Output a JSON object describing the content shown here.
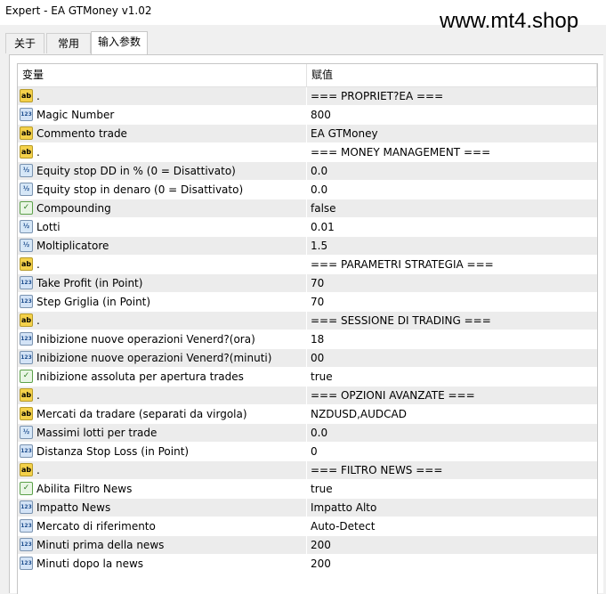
{
  "window": {
    "title": "Expert - EA GTMoney v1.02",
    "watermark": "www.mt4.shop"
  },
  "tabs": [
    {
      "label": "关于"
    },
    {
      "label": "常用"
    },
    {
      "label": "输入参数"
    }
  ],
  "table": {
    "headers": {
      "variable": "变量",
      "value": "赋值"
    },
    "icons": {
      "ab": {
        "glyph": "ab",
        "name": "string-type-icon"
      },
      "int": {
        "glyph": "123",
        "name": "integer-type-icon"
      },
      "dbl": {
        "glyph": "½",
        "name": "double-type-icon"
      },
      "bool": {
        "glyph": "✓",
        "name": "boolean-type-icon"
      }
    },
    "rows": [
      {
        "type": "ab",
        "name": ".",
        "value": "=== PROPRIET?EA ==="
      },
      {
        "type": "int",
        "name": "Magic Number",
        "value": "800"
      },
      {
        "type": "ab",
        "name": "Commento trade",
        "value": "EA GTMoney"
      },
      {
        "type": "ab",
        "name": ".",
        "value": "=== MONEY MANAGEMENT ==="
      },
      {
        "type": "dbl",
        "name": "Equity stop DD in % (0 = Disattivato)",
        "value": "0.0"
      },
      {
        "type": "dbl",
        "name": "Equity stop in denaro (0 = Disattivato)",
        "value": "0.0"
      },
      {
        "type": "bool",
        "name": "Compounding",
        "value": "false"
      },
      {
        "type": "dbl",
        "name": "Lotti",
        "value": "0.01"
      },
      {
        "type": "dbl",
        "name": "Moltiplicatore",
        "value": "1.5"
      },
      {
        "type": "ab",
        "name": ".",
        "value": "=== PARAMETRI STRATEGIA ==="
      },
      {
        "type": "int",
        "name": "Take Profit (in Point)",
        "value": "70"
      },
      {
        "type": "int",
        "name": "Step Griglia (in Point)",
        "value": "70"
      },
      {
        "type": "ab",
        "name": ".",
        "value": "=== SESSIONE DI TRADING ==="
      },
      {
        "type": "int",
        "name": "Inibizione nuove operazioni Venerd?(ora)",
        "value": "18"
      },
      {
        "type": "int",
        "name": "Inibizione nuove operazioni Venerd?(minuti)",
        "value": "00"
      },
      {
        "type": "bool",
        "name": "Inibizione assoluta per apertura trades",
        "value": "true"
      },
      {
        "type": "ab",
        "name": ".",
        "value": "=== OPZIONI AVANZATE ==="
      },
      {
        "type": "ab",
        "name": "Mercati da tradare (separati da virgola)",
        "value": "NZDUSD,AUDCAD"
      },
      {
        "type": "dbl",
        "name": "Massimi lotti per trade",
        "value": "0.0"
      },
      {
        "type": "int",
        "name": "Distanza Stop Loss (in Point)",
        "value": "0"
      },
      {
        "type": "ab",
        "name": ".",
        "value": "=== FILTRO NEWS ==="
      },
      {
        "type": "bool",
        "name": "Abilita Filtro News",
        "value": "true"
      },
      {
        "type": "int",
        "name": "Impatto News",
        "value": "Impatto Alto"
      },
      {
        "type": "int",
        "name": "Mercato di riferimento",
        "value": "Auto-Detect"
      },
      {
        "type": "int",
        "name": "Minuti prima della news",
        "value": "200"
      },
      {
        "type": "int",
        "name": "Minuti dopo la news",
        "value": "200"
      }
    ]
  }
}
